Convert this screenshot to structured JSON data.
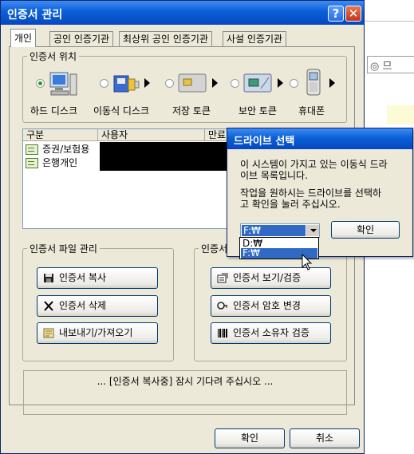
{
  "window": {
    "title": "인증서 관리",
    "help_glyph": "?",
    "close_glyph": "✕"
  },
  "tabs": [
    {
      "label": "개인",
      "active": true
    },
    {
      "label": "공인 인증기관",
      "active": false
    },
    {
      "label": "최상위 공인 인증기관",
      "active": false
    },
    {
      "label": "사설 인증기관",
      "active": false
    }
  ],
  "location": {
    "group_label": "인증서 위치",
    "devices": [
      {
        "label": "하드 디스크",
        "selected": true,
        "icon": "computer-icon"
      },
      {
        "label": "이동식 디스크",
        "selected": false,
        "icon": "usb-drive-icon"
      },
      {
        "label": "저장 토큰",
        "selected": false,
        "icon": "smartcard-icon"
      },
      {
        "label": "보안 토큰",
        "selected": false,
        "icon": "security-token-icon"
      },
      {
        "label": "휴대폰",
        "selected": false,
        "icon": "mobile-phone-icon"
      }
    ]
  },
  "cert_list": {
    "columns": [
      "구분",
      "사용자",
      "만료"
    ],
    "rows": [
      {
        "type": "증권/보험용"
      },
      {
        "type": "은행개인"
      }
    ]
  },
  "file_mgmt": {
    "group_label": "인증서 파일 관리",
    "buttons": [
      {
        "label": "인증서 복사",
        "icon": "floppy-disk-icon"
      },
      {
        "label": "인증서 삭제",
        "icon": "delete-x-icon"
      },
      {
        "label": "내보내기/가져오기",
        "icon": "import-export-icon"
      }
    ]
  },
  "cert_mgmt": {
    "group_label": "인증서",
    "buttons": [
      {
        "label": "인증서 보기/검증",
        "icon": "certificate-view-icon"
      },
      {
        "label": "인증서 암호 변경",
        "icon": "password-key-icon"
      },
      {
        "label": "인증서 소유자 검증",
        "icon": "barcode-icon"
      }
    ]
  },
  "status": "... [인증서 복사중] 잠시 기다려 주십시오 ...",
  "footer": {
    "ok_label": "확인",
    "cancel_label": "취소"
  },
  "dialog": {
    "title": "드라이브 선택",
    "message1_line1": "이 시스템이 가지고 있는 이동식 드라",
    "message1_line2": "이브 목록입니다.",
    "message2_line1": "작업을 원하시는 드라이브를 선택하",
    "message2_line2": "고 확인을 눌러 주십시오.",
    "selected_drive": "F:₩",
    "drive_options": [
      "D:₩",
      "F:₩"
    ],
    "highlighted_option": 1,
    "ok_label": "확인"
  },
  "background_page": {
    "glyphs": "◎ 므"
  },
  "colors": {
    "titlebar": "#0a5fd8",
    "selection": "#316ac5",
    "window_face": "#ece9d8"
  }
}
